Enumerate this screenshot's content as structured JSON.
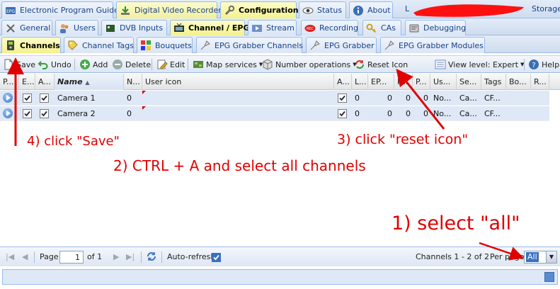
{
  "main_tabs": [
    {
      "label": "Electronic Program Guide",
      "icon": "epg-icon",
      "active": false
    },
    {
      "label": "Digital Video Recorder",
      "icon": "download-icon",
      "active": false
    },
    {
      "label": "Configuration",
      "icon": "wrench-icon",
      "active": true
    },
    {
      "label": "Status",
      "icon": "eye-icon",
      "active": false
    },
    {
      "label": "About",
      "icon": "info-icon",
      "active": false
    }
  ],
  "header_right": {
    "user_initial": "L",
    "storage_label": "Storage"
  },
  "config_tabs": [
    {
      "label": "General",
      "icon": "tools-icon"
    },
    {
      "label": "Users",
      "icon": "users-icon"
    },
    {
      "label": "DVB Inputs",
      "icon": "dvb-card-icon"
    },
    {
      "label": "Channel / EPG",
      "icon": "tv-icon",
      "active": true
    },
    {
      "label": "Stream",
      "icon": "stream-icon"
    },
    {
      "label": "Recording",
      "icon": "rec-icon"
    },
    {
      "label": "CAs",
      "icon": "key-icon"
    },
    {
      "label": "Debugging",
      "icon": "debug-icon"
    }
  ],
  "channel_tabs": [
    {
      "label": "Channels",
      "icon": "channel-icon",
      "active": true
    },
    {
      "label": "Channel Tags",
      "icon": "tag-icon"
    },
    {
      "label": "Bouquets",
      "icon": "bouquet-icon"
    },
    {
      "label": "EPG Grabber Channels",
      "icon": "grabber-icon"
    },
    {
      "label": "EPG Grabber",
      "icon": "grabber-icon"
    },
    {
      "label": "EPG Grabber Modules",
      "icon": "grabber-icon"
    }
  ],
  "toolbar": {
    "save": "Save",
    "undo": "Undo",
    "add": "Add",
    "delete": "Delete",
    "edit": "Edit",
    "map_services": "Map services",
    "number_operations": "Number operations",
    "reset_icon": "Reset Icon",
    "view_level": "View level: Expert",
    "help": "Help"
  },
  "grid": {
    "columns": [
      "P...",
      "E...",
      "A...",
      "Name",
      "N...",
      "User icon",
      "A...",
      "L...",
      "EP...",
      "P...",
      "P...",
      "Us...",
      "Se...",
      "Tags",
      "Bo...",
      "R..."
    ],
    "rows": [
      {
        "enabled": true,
        "autoname": true,
        "name": "Camera 1",
        "number": "0",
        "auto_epg": true,
        "l": "0",
        "ep": "0",
        "p1": "0",
        "p2": "0",
        "us": "No...",
        "se": "Ca...",
        "tags": "CF..."
      },
      {
        "enabled": true,
        "autoname": true,
        "name": "Camera 2",
        "number": "0",
        "auto_epg": true,
        "l": "0",
        "ep": "0",
        "p1": "0",
        "p2": "0",
        "us": "No...",
        "se": "Ca...",
        "tags": "CF..."
      }
    ]
  },
  "pager": {
    "page_label": "Page",
    "page_value": "1",
    "of_label": "of 1",
    "auto_refresh": "Auto-refresh",
    "summary": "Channels 1 - 2 of 2",
    "per_page_label": "Per page",
    "per_page_value": "All"
  },
  "annotations": {
    "step1": "1) select \"all\"",
    "step2": "2) CTRL + A and select all channels",
    "step3": "3) click \"reset icon\"",
    "step4": "4) click \"Save\""
  },
  "colors": {
    "accent": "#15428b",
    "active_tab": "#f4f18d",
    "annotation": "#e00000",
    "row_selected": "#dfe8f6"
  }
}
